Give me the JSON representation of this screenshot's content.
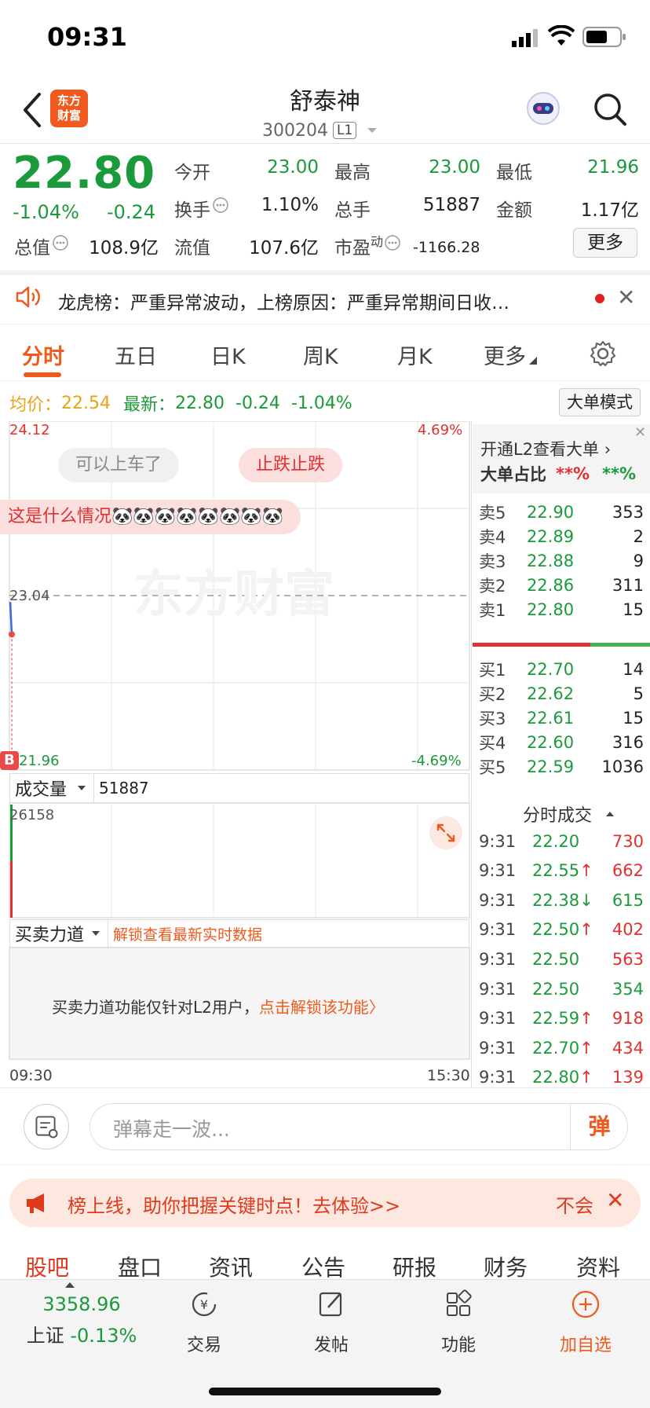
{
  "status_bar": {
    "time": "09:31"
  },
  "header": {
    "logo_line1": "东方",
    "logo_line2": "财富",
    "stock_name": "舒泰神",
    "stock_code": "300204",
    "level_badge": "L1"
  },
  "quote": {
    "price": "22.80",
    "pct_change": "-1.04%",
    "abs_change": "-0.24",
    "fields": {
      "open_label": "今开",
      "open_value": "23.00",
      "high_label": "最高",
      "high_value": "23.00",
      "low_label": "最低",
      "low_value": "21.96",
      "turnover_label": "换手",
      "turnover_value": "1.10%",
      "volume_label": "总手",
      "volume_value": "51887",
      "amount_label": "金额",
      "amount_value": "1.17亿",
      "mktcap_label": "总值",
      "mktcap_value": "108.9亿",
      "float_label": "流值",
      "float_value": "107.6亿",
      "pe_label": "市盈",
      "pe_sup": "动",
      "pe_value": "-1166.28"
    },
    "more_label": "更多"
  },
  "ticker": {
    "text": "龙虎榜：严重异常波动，上榜原因：严重异常期间日收…"
  },
  "tabs": [
    "分时",
    "五日",
    "日K",
    "周K",
    "月K",
    "更多"
  ],
  "info_row": {
    "avg_label": "均价：",
    "avg_value": "22.54",
    "latest_label": "最新：",
    "latest_value": "22.80",
    "change": "-0.24",
    "pct": "-1.04%",
    "big_order_mode": "大单模式"
  },
  "chart": {
    "y_top_price": "24.12",
    "y_top_pct": "4.69%",
    "y_mid_price": "23.04",
    "y_bot_price": "21.96",
    "y_bot_pct": "-4.69%",
    "watermark": "东方财富",
    "bubbles": [
      "可以上车了",
      "止跌止跌",
      "这是什么情况🐼🐼🐼🐼🐼🐼🐼🐼"
    ],
    "b_marker": "B",
    "volume_select": "成交量",
    "volume_value": "51887",
    "volume_max": "26158",
    "force_select": "买卖力道",
    "force_unlock_hint": "解锁查看最新实时数据",
    "force_msg_prefix": "买卖力道功能仅针对L2用户，",
    "force_msg_link": "点击解锁该功能〉",
    "time_start": "09:30",
    "time_end": "15:30"
  },
  "chart_data": {
    "type": "line",
    "x": [
      "09:30",
      "09:31"
    ],
    "series": [
      {
        "values": [
          23.0,
          22.8
        ]
      }
    ],
    "ylim": [
      21.96,
      24.12
    ],
    "reference_price": 23.04
  },
  "order_book": {
    "l2_promo": "开通L2查看大单 ›",
    "big_order_ratio_label": "大单占比",
    "big_order_red": "**%",
    "big_order_green": "**%",
    "asks": [
      {
        "label": "卖5",
        "price": "22.90",
        "vol": "353",
        "color": "green"
      },
      {
        "label": "卖4",
        "price": "22.89",
        "vol": "2",
        "color": "green"
      },
      {
        "label": "卖3",
        "price": "22.88",
        "vol": "9",
        "color": "green"
      },
      {
        "label": "卖2",
        "price": "22.86",
        "vol": "311",
        "color": "green"
      },
      {
        "label": "卖1",
        "price": "22.80",
        "vol": "15",
        "color": "green"
      }
    ],
    "bids": [
      {
        "label": "买1",
        "price": "22.70",
        "vol": "14",
        "color": "green"
      },
      {
        "label": "买2",
        "price": "22.62",
        "vol": "5",
        "color": "green"
      },
      {
        "label": "买3",
        "price": "22.61",
        "vol": "15",
        "color": "green"
      },
      {
        "label": "买4",
        "price": "22.60",
        "vol": "316",
        "color": "green"
      },
      {
        "label": "买5",
        "price": "22.59",
        "vol": "1036",
        "color": "green"
      }
    ],
    "trades_title": "分时成交",
    "trades": [
      {
        "time": "9:31",
        "price": "22.20",
        "arrow": "",
        "vol": "730",
        "vol_color": "red"
      },
      {
        "time": "9:31",
        "price": "22.55",
        "arrow": "↑",
        "vol": "662",
        "vol_color": "red"
      },
      {
        "time": "9:31",
        "price": "22.38",
        "arrow": "↓",
        "vol": "615",
        "vol_color": "green"
      },
      {
        "time": "9:31",
        "price": "22.50",
        "arrow": "↑",
        "vol": "402",
        "vol_color": "red"
      },
      {
        "time": "9:31",
        "price": "22.50",
        "arrow": "",
        "vol": "563",
        "vol_color": "red"
      },
      {
        "time": "9:31",
        "price": "22.50",
        "arrow": "",
        "vol": "354",
        "vol_color": "green"
      },
      {
        "time": "9:31",
        "price": "22.59",
        "arrow": "↑",
        "vol": "918",
        "vol_color": "red"
      },
      {
        "time": "9:31",
        "price": "22.70",
        "arrow": "↑",
        "vol": "434",
        "vol_color": "red"
      },
      {
        "time": "9:31",
        "price": "22.80",
        "arrow": "↑",
        "vol": "139",
        "vol_color": "red"
      }
    ]
  },
  "comment": {
    "placeholder": "弹幕走一波...",
    "danmu_btn": "弹"
  },
  "promo": {
    "text": "榜上线，助你把握关键时点！去体验>>",
    "dismiss": "不会"
  },
  "sub_tabs": [
    "股吧",
    "盘口",
    "资讯",
    "公告",
    "研报",
    "财务",
    "资料"
  ],
  "bottom_nav": {
    "index_value": "3358.96",
    "index_name": "上证",
    "index_change": "-0.13%",
    "items": [
      "交易",
      "发帖",
      "功能",
      "加自选"
    ]
  },
  "colors": {
    "up": "#e03030",
    "down": "#1a9a3a",
    "brand": "#f05a1e",
    "avg": "#e8a317"
  }
}
